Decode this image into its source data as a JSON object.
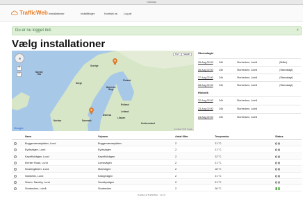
{
  "window": {
    "title": "TrafficWeb"
  },
  "navbar": {
    "brand": "TrafficWeb",
    "links": [
      "Installationer",
      "Indstillinger",
      "Kontakt os",
      "Log af"
    ]
  },
  "alert": {
    "message": "Du er nu logget ind.",
    "close": "×"
  },
  "page": {
    "title": "Vælg installationer"
  },
  "map": {
    "type_buttons": [
      "Kort",
      "Satellit"
    ],
    "labels": {
      "sweden": "Sverige",
      "finland": "Finland",
      "norway": "Norge",
      "estonia": "Estland",
      "latvia": "Letland",
      "lithuania": "Litauen",
      "denmark": "Danmark",
      "norwegian_sea": "Norske\nHav",
      "north_sea": "Nordsø",
      "belarus": "Hviderusland",
      "baltic_sea": "Østersø",
      "gulf": "Botniske\nBugt"
    },
    "provider": "Google",
    "copyright": "Kortdata ©2015 Google"
  },
  "schedule": {
    "heading": "Skemalagte",
    "rows": [
      {
        "date": "26-Aug 02:00",
        "hours": "24h",
        "installation": "Storbecken, Luleå",
        "status": "(Måler)"
      },
      {
        "date": "26-Aug 02:00",
        "hours": "24h",
        "installation": "Storbecken, Luleå",
        "status": "(Skemalagt)"
      },
      {
        "date": "27-Aug 02:00",
        "hours": "24h",
        "installation": "Storbecken, Luleå",
        "status": "(Skemalagt)"
      },
      {
        "date": "28-Aug 02:00",
        "hours": "24h",
        "installation": "Storbecken, Luleå",
        "status": "(Skemalagt)"
      }
    ],
    "history_heading": "Historik",
    "history": [
      {
        "date": "22-Aug 02:00",
        "hours": "24h",
        "installation": "Storbecken, Luleå"
      },
      {
        "date": "23-Aug 02:00",
        "hours": "24h",
        "installation": "Storbecken, Luleå"
      },
      {
        "date": "24-Aug 02:00",
        "hours": "24h",
        "installation": "Storbecken, Luleå"
      }
    ]
  },
  "table": {
    "headers": [
      "Navn",
      "Vejnavn",
      "Antal filter",
      "Temperatur",
      "Status"
    ],
    "rows": [
      {
        "name": "Boggervænsejakten, Lund",
        "street": "Boggervænsejakten",
        "filters": "2",
        "temp": "21 °C",
        "status": "ok"
      },
      {
        "name": "Eydsvägen, Lund",
        "street": "Eydsvägen",
        "filters": "2",
        "temp": "21 °C",
        "status": "ok"
      },
      {
        "name": "Kapriflolvägen, Lund",
        "street": "Kapriflolvägen",
        "filters": "2",
        "temp": "22 °C",
        "status": "ok"
      },
      {
        "name": "Klerker Road, Lund",
        "street": "Lomavägen",
        "filters": "2",
        "temp": "21 °C",
        "status": "ok"
      },
      {
        "name": "Klostergården, Lund",
        "street": "Mulevägen",
        "filters": "2",
        "temp": "18 °C",
        "status": "ok"
      },
      {
        "name": "Nobbelöv, Lund",
        "street": "Kastgrvägen",
        "filters": "2",
        "temp": "21 °C",
        "status": "ok"
      },
      {
        "name": "Stad v. Sandby, Lund",
        "street": "Sandbyvägen",
        "filters": "2",
        "temp": "21 °C",
        "status": "ok"
      },
      {
        "name": "Storbecken, Luleå",
        "street": "Storbecken",
        "filters": "2",
        "temp": "26 °C",
        "status": "running"
      }
    ]
  },
  "footer": {
    "text": "Udviklet af TrafficWeb · v1.2.0"
  },
  "colors": {
    "brand": "#e77a22",
    "alert_bg": "#dff0d8",
    "ok_icon": "#555555",
    "running_icon": "#3aa02b",
    "water": "#a8c8e8",
    "land": "#d7e6c7"
  }
}
